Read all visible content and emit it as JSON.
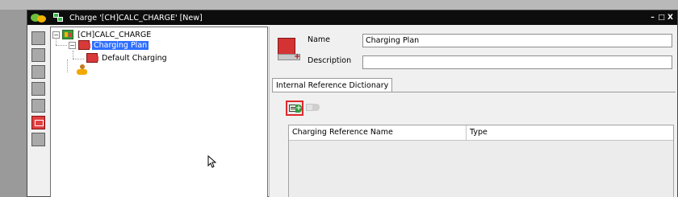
{
  "window": {
    "title": "Charge '[CH]CALC_CHARGE' [New]",
    "controls": [
      "–",
      "□",
      "X"
    ]
  },
  "toolbar_left": {
    "items": [
      "tool-1",
      "tool-2",
      "tool-3",
      "tool-4",
      "tool-5",
      "tool-6-active",
      "tool-7"
    ]
  },
  "tree": {
    "root": {
      "label": "[CH]CALC_CHARGE",
      "expander": "−"
    },
    "plan": {
      "label": "Charging Plan",
      "expander": "−",
      "selected": true
    },
    "default": {
      "label": "Default Charging"
    }
  },
  "form": {
    "name_label": "Name",
    "name_value": "Charging Plan",
    "description_label": "Description",
    "description_value": ""
  },
  "tabs": [
    {
      "label": "Internal Reference Dictionary",
      "active": true
    }
  ],
  "table": {
    "columns": [
      "Charging Reference Name",
      "Type"
    ],
    "rows": []
  },
  "colors": {
    "titlebar": "#0d0d0d",
    "selection": "#2f6fff",
    "highlight_border": "#e0282c"
  }
}
